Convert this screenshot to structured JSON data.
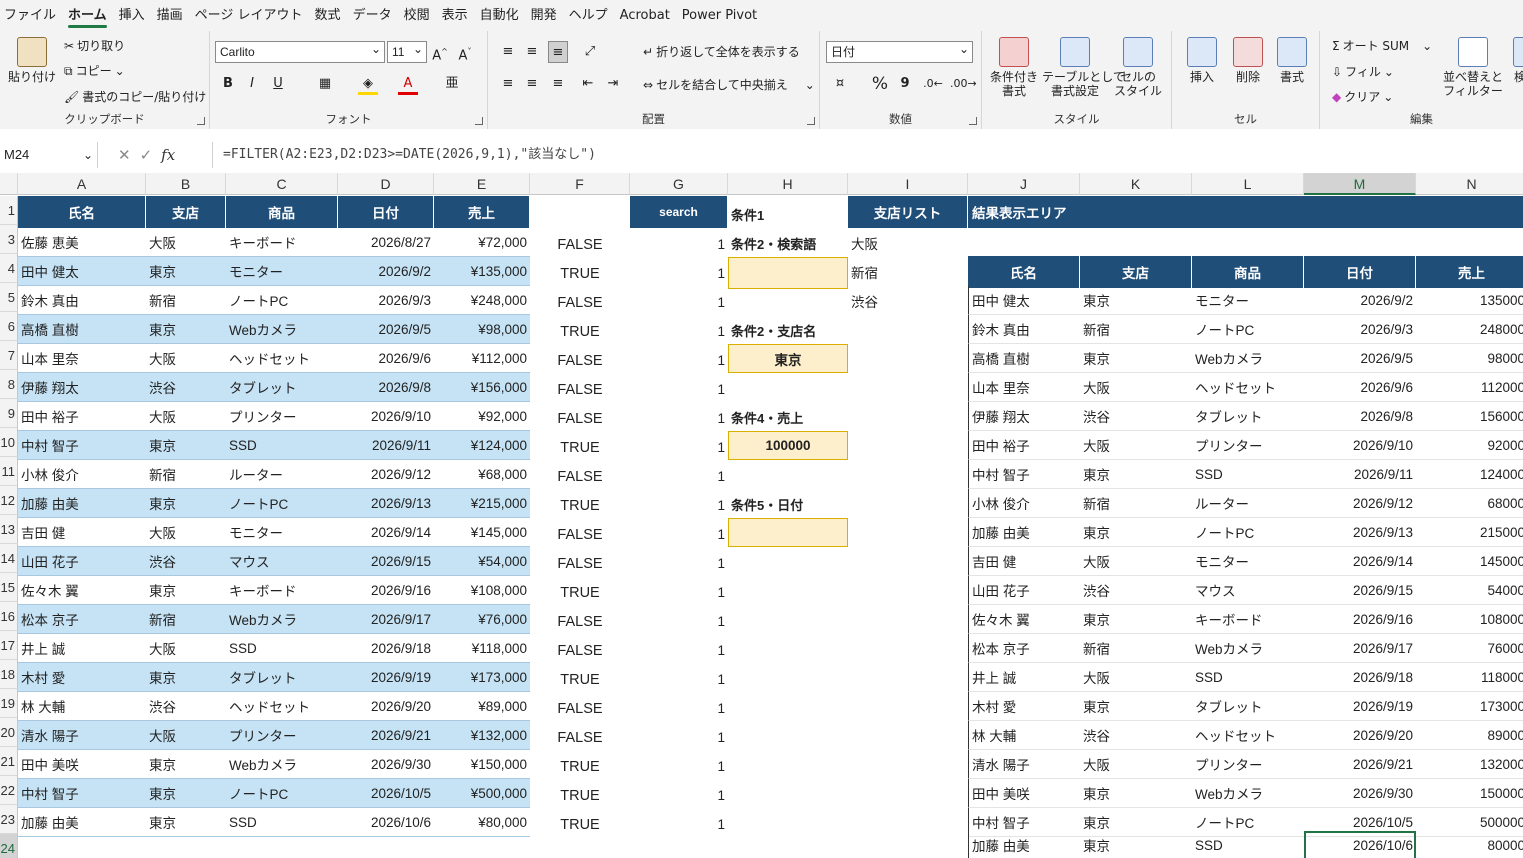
{
  "menu": [
    "ファイル",
    "ホーム",
    "挿入",
    "描画",
    "ページ レイアウト",
    "数式",
    "データ",
    "校閲",
    "表示",
    "自動化",
    "開発",
    "ヘルプ",
    "Acrobat",
    "Power Pivot"
  ],
  "ribbon": {
    "clipboard": {
      "paste": "貼り付け",
      "cut": "切り取り",
      "copy": "コピー",
      "format_painter": "書式のコピー/貼り付け",
      "label": "クリップボード"
    },
    "font": {
      "name": "Carlito",
      "size": "11",
      "label": "フォント",
      "grow": "A^",
      "shrink": "A˅",
      "bold": "B",
      "italic": "I",
      "underline": "U"
    },
    "alignment": {
      "wrap": "折り返して全体を表示する",
      "merge": "セルを結合して中央揃え",
      "label": "配置"
    },
    "number": {
      "format": "日付",
      "label": "数値",
      "percent": "%",
      "comma": "9"
    },
    "styles": {
      "conditional": "条件付き\n書式",
      "table": "テーブルとして\n書式設定",
      "cell": "セルの\nスタイル",
      "label": "スタイル"
    },
    "cells": {
      "insert": "挿入",
      "delete": "削除",
      "format": "書式",
      "label": "セル"
    },
    "editing": {
      "autosum": "オート SUM",
      "fill": "フィル",
      "clear": "クリア",
      "sort": "並べ替えと\nフィルター",
      "find": "検",
      "label": "編集"
    }
  },
  "formula_bar": {
    "name_box": "M24",
    "fx": "fx",
    "formula": "=FILTER(A2:E23,D2:D23>=DATE(2026,9,1),\"該当なし\")"
  },
  "columns": [
    "A",
    "B",
    "C",
    "D",
    "E",
    "F",
    "G",
    "H",
    "I",
    "J",
    "K",
    "L",
    "M",
    "N"
  ],
  "rows": [
    "1",
    "3",
    "4",
    "5",
    "6",
    "7",
    "8",
    "9",
    "10",
    "11",
    "12",
    "13",
    "14",
    "15",
    "16",
    "17",
    "18",
    "19",
    "20",
    "21",
    "22",
    "23",
    "24"
  ],
  "headers": {
    "name": "氏名",
    "branch": "支店",
    "product": "商品",
    "date": "日付",
    "sales": "売上",
    "search": "search",
    "branch_list": "支店リスト",
    "result_area": "結果表示エリア"
  },
  "sheet": [
    {
      "a": "佐藤 恵美",
      "b": "大阪",
      "c": "キーボード",
      "d": "2026/8/27",
      "e": "¥72,000",
      "f": "FALSE",
      "g": "1"
    },
    {
      "a": "田中 健太",
      "b": "東京",
      "c": "モニター",
      "d": "2026/9/2",
      "e": "¥135,000",
      "f": "TRUE",
      "g": "1"
    },
    {
      "a": "鈴木 真由",
      "b": "新宿",
      "c": "ノートPC",
      "d": "2026/9/3",
      "e": "¥248,000",
      "f": "FALSE",
      "g": "1"
    },
    {
      "a": "高橋 直樹",
      "b": "東京",
      "c": "Webカメラ",
      "d": "2026/9/5",
      "e": "¥98,000",
      "f": "TRUE",
      "g": "1"
    },
    {
      "a": "山本 里奈",
      "b": "大阪",
      "c": "ヘッドセット",
      "d": "2026/9/6",
      "e": "¥112,000",
      "f": "FALSE",
      "g": "1"
    },
    {
      "a": "伊藤 翔太",
      "b": "渋谷",
      "c": "タブレット",
      "d": "2026/9/8",
      "e": "¥156,000",
      "f": "FALSE",
      "g": "1"
    },
    {
      "a": "田中 裕子",
      "b": "大阪",
      "c": "プリンター",
      "d": "2026/9/10",
      "e": "¥92,000",
      "f": "FALSE",
      "g": "1"
    },
    {
      "a": "中村 智子",
      "b": "東京",
      "c": "SSD",
      "d": "2026/9/11",
      "e": "¥124,000",
      "f": "TRUE",
      "g": "1"
    },
    {
      "a": "小林 俊介",
      "b": "新宿",
      "c": "ルーター",
      "d": "2026/9/12",
      "e": "¥68,000",
      "f": "FALSE",
      "g": "1"
    },
    {
      "a": "加藤 由美",
      "b": "東京",
      "c": "ノートPC",
      "d": "2026/9/13",
      "e": "¥215,000",
      "f": "TRUE",
      "g": "1"
    },
    {
      "a": "吉田 健",
      "b": "大阪",
      "c": "モニター",
      "d": "2026/9/14",
      "e": "¥145,000",
      "f": "FALSE",
      "g": "1"
    },
    {
      "a": "山田 花子",
      "b": "渋谷",
      "c": "マウス",
      "d": "2026/9/15",
      "e": "¥54,000",
      "f": "FALSE",
      "g": "1"
    },
    {
      "a": "佐々木 翼",
      "b": "東京",
      "c": "キーボード",
      "d": "2026/9/16",
      "e": "¥108,000",
      "f": "TRUE",
      "g": "1"
    },
    {
      "a": "松本 京子",
      "b": "新宿",
      "c": "Webカメラ",
      "d": "2026/9/17",
      "e": "¥76,000",
      "f": "FALSE",
      "g": "1"
    },
    {
      "a": "井上 誠",
      "b": "大阪",
      "c": "SSD",
      "d": "2026/9/18",
      "e": "¥118,000",
      "f": "FALSE",
      "g": "1"
    },
    {
      "a": "木村 愛",
      "b": "東京",
      "c": "タブレット",
      "d": "2026/9/19",
      "e": "¥173,000",
      "f": "TRUE",
      "g": "1"
    },
    {
      "a": "林 大輔",
      "b": "渋谷",
      "c": "ヘッドセット",
      "d": "2026/9/20",
      "e": "¥89,000",
      "f": "FALSE",
      "g": "1"
    },
    {
      "a": "清水 陽子",
      "b": "大阪",
      "c": "プリンター",
      "d": "2026/9/21",
      "e": "¥132,000",
      "f": "FALSE",
      "g": "1"
    },
    {
      "a": "田中 美咲",
      "b": "東京",
      "c": "Webカメラ",
      "d": "2026/9/30",
      "e": "¥150,000",
      "f": "TRUE",
      "g": "1"
    },
    {
      "a": "中村 智子",
      "b": "東京",
      "c": "ノートPC",
      "d": "2026/10/5",
      "e": "¥500,000",
      "f": "TRUE",
      "g": "1"
    },
    {
      "a": "加藤 由美",
      "b": "東京",
      "c": "SSD",
      "d": "2026/10/6",
      "e": "¥80,000",
      "f": "TRUE",
      "g": "1"
    }
  ],
  "conditions": {
    "c1": "条件1",
    "c2": "条件2・検索語",
    "c2_value": "",
    "c3": "条件2・支店名",
    "c3_value": "東京",
    "c4": "条件4・売上",
    "c4_value": "100000",
    "c5": "条件5・日付",
    "c5_value": ""
  },
  "branches": [
    "大阪",
    "新宿",
    "渋谷"
  ],
  "results": [
    {
      "a": "田中 健太",
      "b": "東京",
      "c": "モニター",
      "d": "2026/9/2",
      "e": "135000"
    },
    {
      "a": "鈴木 真由",
      "b": "新宿",
      "c": "ノートPC",
      "d": "2026/9/3",
      "e": "248000"
    },
    {
      "a": "高橋 直樹",
      "b": "東京",
      "c": "Webカメラ",
      "d": "2026/9/5",
      "e": "98000"
    },
    {
      "a": "山本 里奈",
      "b": "大阪",
      "c": "ヘッドセット",
      "d": "2026/9/6",
      "e": "112000"
    },
    {
      "a": "伊藤 翔太",
      "b": "渋谷",
      "c": "タブレット",
      "d": "2026/9/8",
      "e": "156000"
    },
    {
      "a": "田中 裕子",
      "b": "大阪",
      "c": "プリンター",
      "d": "2026/9/10",
      "e": "92000"
    },
    {
      "a": "中村 智子",
      "b": "東京",
      "c": "SSD",
      "d": "2026/9/11",
      "e": "124000"
    },
    {
      "a": "小林 俊介",
      "b": "新宿",
      "c": "ルーター",
      "d": "2026/9/12",
      "e": "68000"
    },
    {
      "a": "加藤 由美",
      "b": "東京",
      "c": "ノートPC",
      "d": "2026/9/13",
      "e": "215000"
    },
    {
      "a": "吉田 健",
      "b": "大阪",
      "c": "モニター",
      "d": "2026/9/14",
      "e": "145000"
    },
    {
      "a": "山田 花子",
      "b": "渋谷",
      "c": "マウス",
      "d": "2026/9/15",
      "e": "54000"
    },
    {
      "a": "佐々木 翼",
      "b": "東京",
      "c": "キーボード",
      "d": "2026/9/16",
      "e": "108000"
    },
    {
      "a": "松本 京子",
      "b": "新宿",
      "c": "Webカメラ",
      "d": "2026/9/17",
      "e": "76000"
    },
    {
      "a": "井上 誠",
      "b": "大阪",
      "c": "SSD",
      "d": "2026/9/18",
      "e": "118000"
    },
    {
      "a": "木村 愛",
      "b": "東京",
      "c": "タブレット",
      "d": "2026/9/19",
      "e": "173000"
    },
    {
      "a": "林 大輔",
      "b": "渋谷",
      "c": "ヘッドセット",
      "d": "2026/9/20",
      "e": "89000"
    },
    {
      "a": "清水 陽子",
      "b": "大阪",
      "c": "プリンター",
      "d": "2026/9/21",
      "e": "132000"
    },
    {
      "a": "田中 美咲",
      "b": "東京",
      "c": "Webカメラ",
      "d": "2026/9/30",
      "e": "150000"
    },
    {
      "a": "中村 智子",
      "b": "東京",
      "c": "ノートPC",
      "d": "2026/10/5",
      "e": "500000"
    },
    {
      "a": "加藤 由美",
      "b": "東京",
      "c": "SSD",
      "d": "2026/10/6",
      "e": "80000"
    }
  ],
  "colors": {
    "header_bg": "#1f4e79",
    "stripe": "#c5e3f5",
    "input_bg": "#fdefcc",
    "selection": "#217346"
  }
}
